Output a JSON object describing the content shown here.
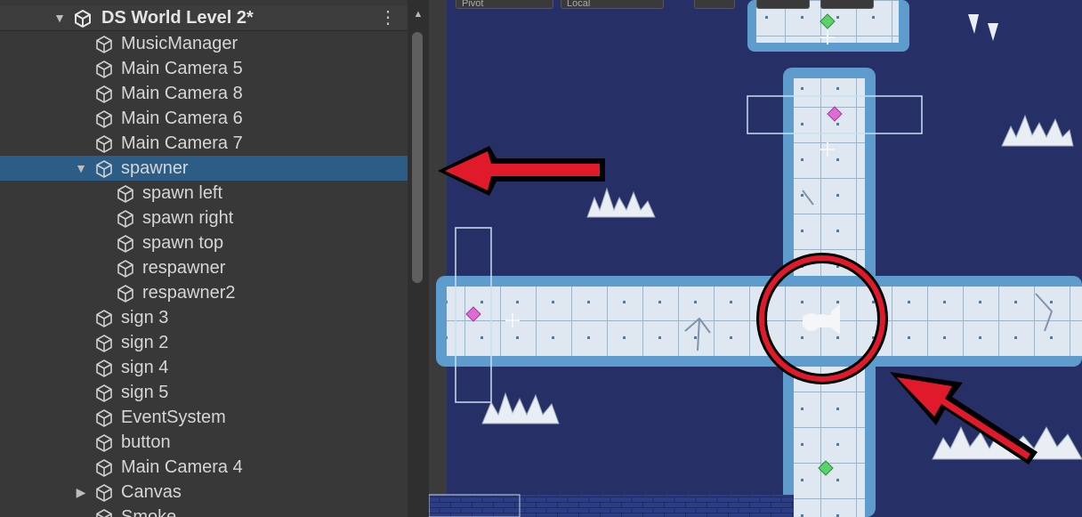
{
  "hierarchy": {
    "scene_name": "DS World Level 2*",
    "items": [
      {
        "label": "MusicManager"
      },
      {
        "label": "Main Camera 5"
      },
      {
        "label": "Main Camera 8"
      },
      {
        "label": "Main Camera 6"
      },
      {
        "label": "Main Camera 7"
      },
      {
        "label": "spawner"
      },
      {
        "label": "spawn left"
      },
      {
        "label": "spawn right"
      },
      {
        "label": "spawn top"
      },
      {
        "label": "respawner"
      },
      {
        "label": "respawner2"
      },
      {
        "label": "sign 3"
      },
      {
        "label": "sign 2"
      },
      {
        "label": "sign 4"
      },
      {
        "label": "sign 5"
      },
      {
        "label": "EventSystem"
      },
      {
        "label": "button"
      },
      {
        "label": "Main Camera 4"
      },
      {
        "label": "Canvas"
      },
      {
        "label": "Smoke"
      }
    ]
  },
  "scene_toolbar": {
    "pivot": "Pivot",
    "space": "Local"
  },
  "icons": {
    "scene": "unity-logo-icon",
    "object": "gameobject-cube-icon",
    "menu": "kebab-menu-icon",
    "expand": "triangle-expand-icon",
    "camera": "camera-gizmo-icon"
  },
  "colors": {
    "selected_row": "#2c5d87",
    "panel_bg": "#383838",
    "scene_bg": "#263066",
    "annotation_red": "#e0192b",
    "tile": "#dfe8f1",
    "tile_border": "#5d9ccd"
  }
}
